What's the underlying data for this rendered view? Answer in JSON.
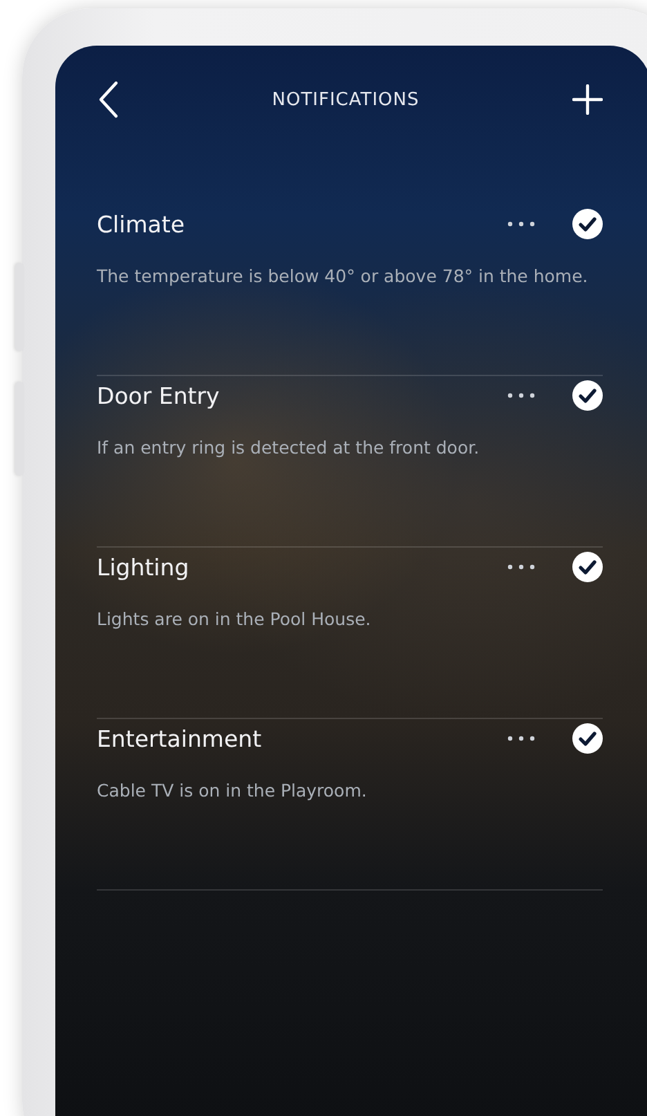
{
  "header": {
    "title": "NOTIFICATIONS"
  },
  "notifications": [
    {
      "title": "Climate",
      "description": "The temperature is below 40° or above 78° in the home.",
      "checked": true
    },
    {
      "title": "Door Entry",
      "description": "If an entry ring is detected at the front door.",
      "checked": true
    },
    {
      "title": "Lighting",
      "description": "Lights are on in the Pool House.",
      "checked": true
    },
    {
      "title": "Entertainment",
      "description": "Cable TV is on in the Playroom.",
      "checked": true
    }
  ]
}
